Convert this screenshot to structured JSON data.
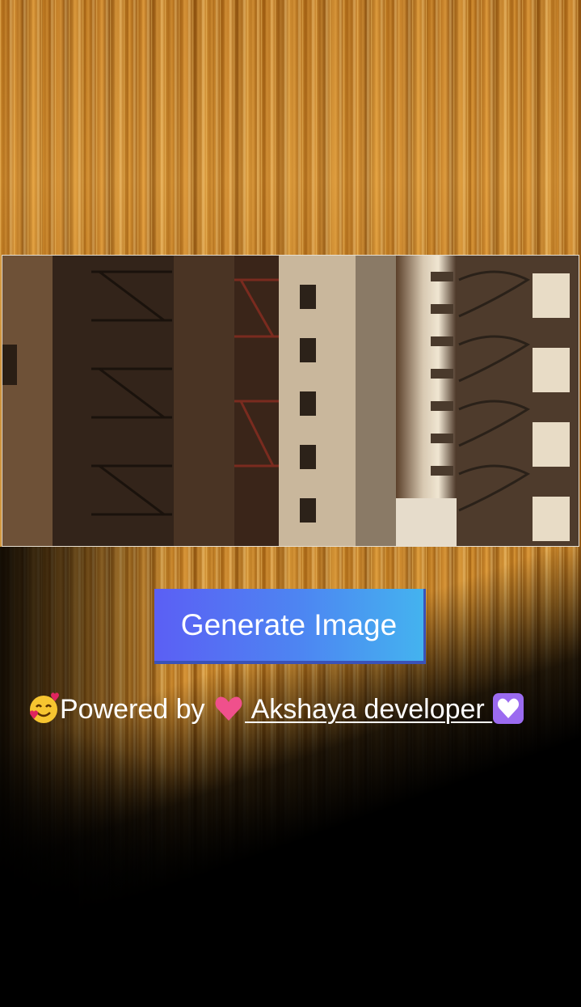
{
  "hero": {
    "background_icon": "golden-light-streaks",
    "photo_icon": "city-buildings-fire-escapes"
  },
  "actions": {
    "generate_label": "Generate Image"
  },
  "credit": {
    "prefix_icon": "smiling-face-with-hearts-emoji",
    "prefix_text": "Powered by ",
    "link_text": " Akshaya developer ",
    "link_before_icon": "pink-heart-emoji",
    "link_after_icon": "white-heart-emoji"
  },
  "colors": {
    "button_gradient_start": "#5b5ff4",
    "button_gradient_end": "#44b3ef",
    "accent_gold": "#c88732"
  }
}
